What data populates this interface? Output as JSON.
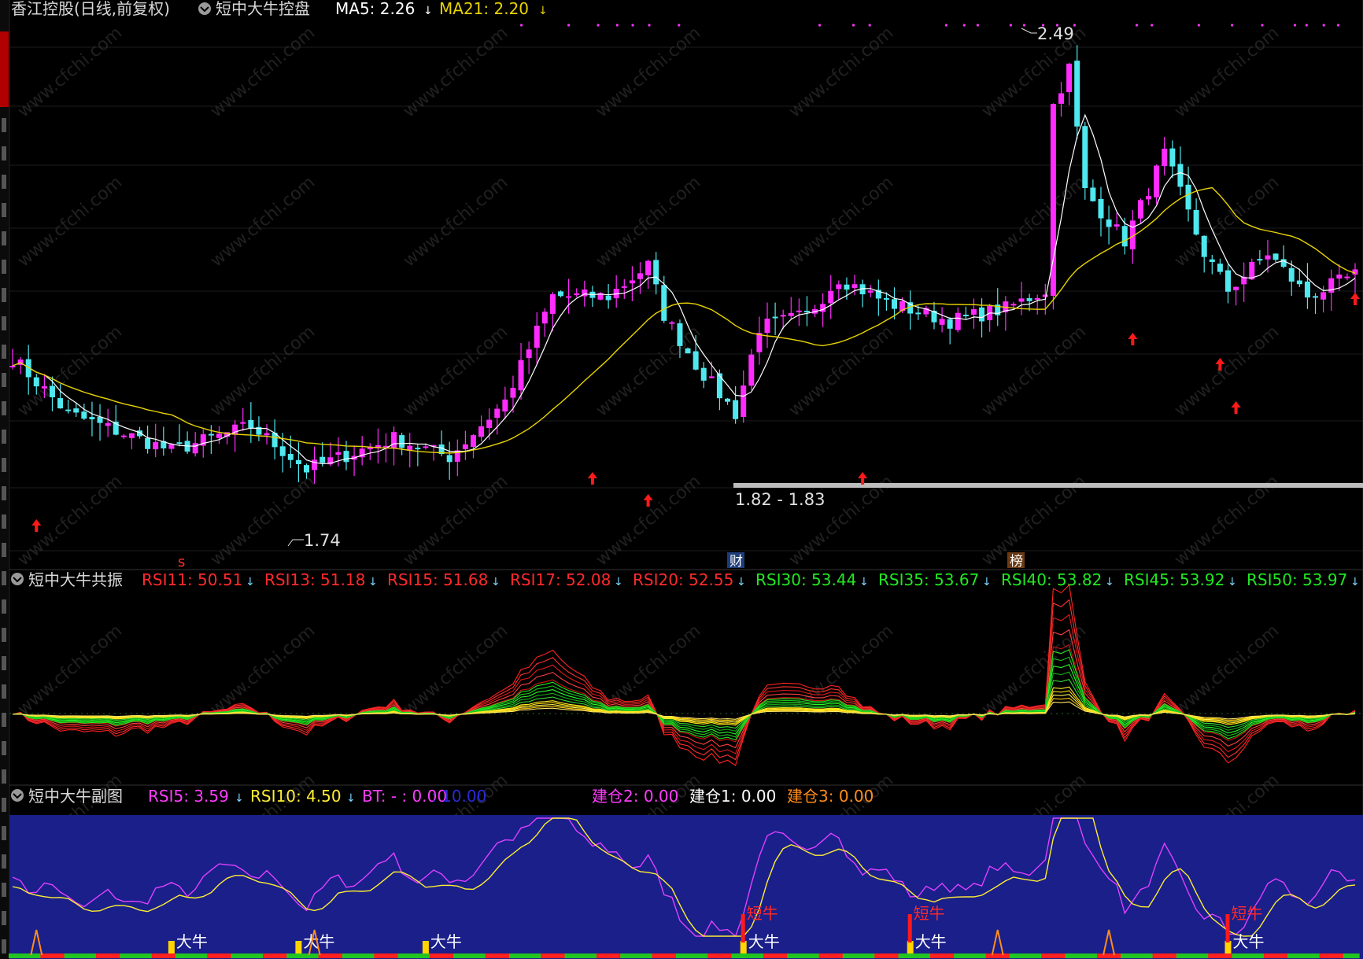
{
  "main_panel": {
    "title": "香江控股(日线,前复权)",
    "indicator_name": "短中大牛控盘",
    "ma5_label": "MA5: 2.26",
    "ma21_label": "MA21: 2.20",
    "price_high_label": "2.49",
    "price_low_label": "1.74",
    "range_label": "1.82 - 1.83",
    "marker_cai": "财",
    "marker_bang": "榜",
    "marker_s": "s",
    "colors": {
      "up": "#ff2cff",
      "down": "#4fe8ef",
      "ma5": "#ffffff",
      "ma21": "#e8d400",
      "arrow": "#ff1a1a"
    }
  },
  "middle_panel": {
    "indicator_name": "短中大牛共振",
    "rsi_labels": [
      {
        "text": "RSI11: 50.51",
        "color": "#ff2a2a"
      },
      {
        "text": "RSI13: 51.18",
        "color": "#ff2a2a"
      },
      {
        "text": "RSI15: 51.68",
        "color": "#ff2a2a"
      },
      {
        "text": "RSI17: 52.08",
        "color": "#ff2a2a"
      },
      {
        "text": "RSI20: 52.55",
        "color": "#ff2a2a"
      },
      {
        "text": "RSI30: 53.44",
        "color": "#22e622"
      },
      {
        "text": "RSI35: 53.67",
        "color": "#22e622"
      },
      {
        "text": "RSI40: 53.82",
        "color": "#22e622"
      },
      {
        "text": "RSI45: 53.92",
        "color": "#22e622"
      },
      {
        "text": "RSI50: 53.97",
        "color": "#22e622"
      }
    ]
  },
  "bottom_panel": {
    "indicator_name": "短中大牛副图",
    "labels": [
      {
        "text": "RSI5: 3.59",
        "color": "#ff3cff"
      },
      {
        "text": "RSI10: 4.50",
        "color": "#ffee33"
      },
      {
        "text": "BT: - : 0.00",
        "color": "#ff3cff"
      },
      {
        "text": ": 10.00",
        "color": "#2a2ad8"
      },
      {
        "text": "建仓2: 0.00",
        "color": "#ff3cff"
      },
      {
        "text": "建仓1: 0.00",
        "color": "#ffffff"
      },
      {
        "text": "建仓3: 0.00",
        "color": "#ff8c1a"
      }
    ],
    "signal_big": "大牛",
    "signal_short": "短牛"
  },
  "watermark": "www.cfchi.com"
}
